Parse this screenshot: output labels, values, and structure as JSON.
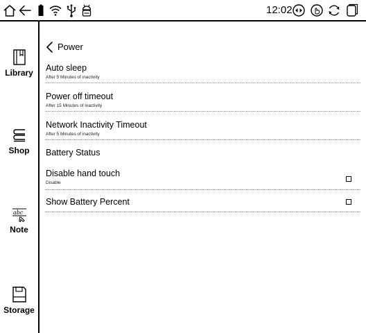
{
  "status_bar": {
    "time": "12:02",
    "icons": [
      "home-icon",
      "back-arrow-icon",
      "battery-icon",
      "wifi-icon",
      "usb-icon",
      "android-icon",
      "refresh-mode-icon",
      "touch-icon",
      "sync-icon",
      "tab-switch-icon"
    ]
  },
  "sidebar": {
    "items": [
      {
        "label": "Library",
        "icon": "library-book-icon"
      },
      {
        "label": "Shop",
        "icon": "shop-books-icon"
      },
      {
        "label": "Note",
        "icon": "note-pen-icon"
      },
      {
        "label": "Storage",
        "icon": "storage-icon"
      }
    ]
  },
  "page": {
    "back_label": "Power"
  },
  "settings": [
    {
      "title": "Auto sleep",
      "subtitle": "After 5 Minutes of inactivity"
    },
    {
      "title": "Power off timeout",
      "subtitle": "After 15 Minutes of inactivity"
    },
    {
      "title": "Network Inactivity Timeout",
      "subtitle": "After 5 Minutes of inactivity"
    },
    {
      "title": "Battery Status",
      "subtitle": ""
    },
    {
      "title": "Disable hand touch",
      "subtitle": "Disable",
      "checked": false
    },
    {
      "title": "Show Battery Percent",
      "subtitle": "",
      "checked": false
    }
  ]
}
